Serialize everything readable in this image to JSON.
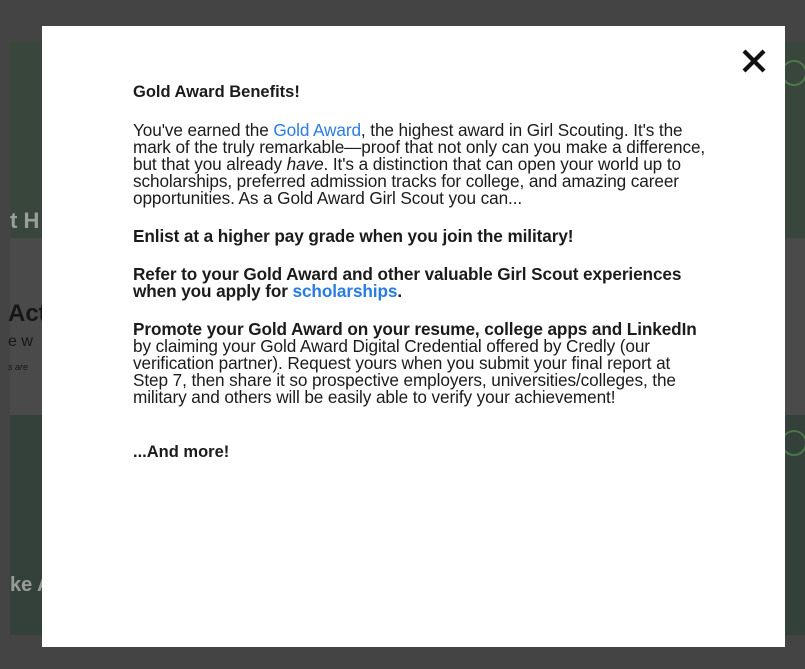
{
  "background": {
    "fragment_1": "t H",
    "fragment_2": "Act",
    "fragment_3": "e w",
    "fragment_4": "s are",
    "fragment_5": "ke A"
  },
  "modal": {
    "close_label": "✕",
    "heading": "Gold Award Benefits!",
    "intro": {
      "before_link": "You've earned the ",
      "link": "Gold Award",
      "after_link": ", the highest award in Girl Scouting. It's the mark of the truly remarkable—proof that not only can you make a difference, but that you already ",
      "emphasis": "have",
      "after_emphasis": ". It's a distinction that can open your world up to scholarships, preferred admission tracks for college, and amazing career opportunities. As a Gold Award Girl Scout you can..."
    },
    "benefit_1": "Enlist at a higher pay grade when you join the military!",
    "benefit_2": {
      "before_link": "Refer to your Gold Award and other valuable Girl Scout experiences when you apply for ",
      "link": "scholarships",
      "after_link": "."
    },
    "benefit_3": {
      "bold": "Promote your Gold Award on your resume, college apps and LinkedIn",
      "rest": " by claiming your Gold Award Digital Credential offered by Credly (our verification partner). Request yours when you submit your final report at Step 7, then share it so prospective employers, universities/colleges, the military and others will be easily able to verify your achievement!"
    },
    "more": "...And more!"
  },
  "colors": {
    "overlay": "#444444",
    "modal_bg": "#ffffff",
    "text": "#1b1b1b",
    "link": "#2a7ce5"
  }
}
